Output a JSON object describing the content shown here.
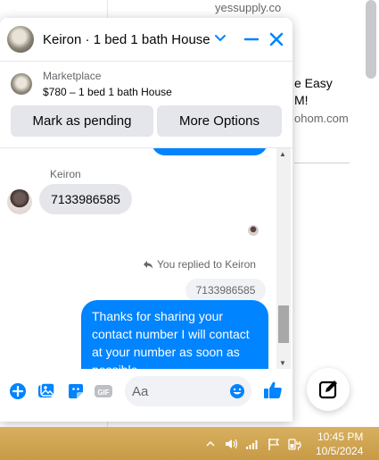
{
  "background": {
    "domain_text": "yessupply.co",
    "ad_title_line1": "e Easy",
    "ad_title_line2": "M!",
    "ad_domain": "ohom.com"
  },
  "chat": {
    "title": "Keiron · 1 bed 1 bath House",
    "marketplace": {
      "source": "Marketplace",
      "listing": "$780 – 1 bed 1 bath House"
    },
    "buttons": {
      "mark_pending": "Mark as pending",
      "more_options": "More Options"
    },
    "thread": {
      "sender_name": "Keiron",
      "incoming_message": "7133986585",
      "replied_label": "You replied to Keiron",
      "quoted_message": "7133986585",
      "outgoing_message": "Thanks for sharing your contact number I will contact at your number as soon as possible"
    },
    "composer": {
      "placeholder": "Aa",
      "icons": [
        "plus-circle-icon",
        "photo-icon",
        "sticker-icon",
        "gif-icon",
        "emoji-icon",
        "thumbs-up-icon"
      ]
    },
    "colors": {
      "accent": "#0084ff",
      "bubble_in": "#e4e6eb"
    }
  },
  "taskbar": {
    "time": "10:45 PM",
    "date": "10/5/2024"
  }
}
